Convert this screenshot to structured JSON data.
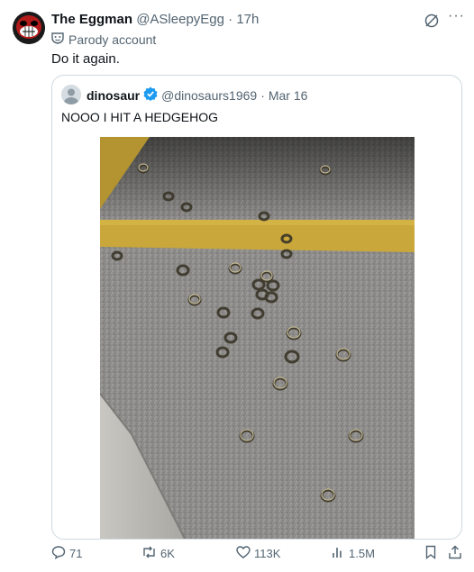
{
  "tweet": {
    "display_name": "The Eggman",
    "handle": "@ASleepyEgg",
    "separator": "·",
    "time": "17h",
    "label": "Parody account",
    "text": "Do it again."
  },
  "quote": {
    "display_name": "dinosaur",
    "handle": "@dinosaurs1969",
    "separator": "·",
    "date": "Mar 16",
    "text": "NOOO I HIT A HEDGEHOG",
    "verified": true
  },
  "actions": {
    "replies": "71",
    "reposts": "6K",
    "likes": "113K",
    "views": "1.5M"
  },
  "icons": {
    "grok": "grok-icon",
    "more": "more-icon",
    "parody": "parody-mask-icon",
    "verified": "verified-badge-icon",
    "reply": "reply-icon",
    "repost": "repost-icon",
    "like": "like-icon",
    "views": "views-icon",
    "bookmark": "bookmark-icon",
    "share": "share-icon"
  },
  "colors": {
    "text": "#0f1419",
    "secondary": "#536471",
    "verified": "#1d9bf0",
    "road_line": "#d9b33a",
    "asphalt": "#8a8a88"
  }
}
